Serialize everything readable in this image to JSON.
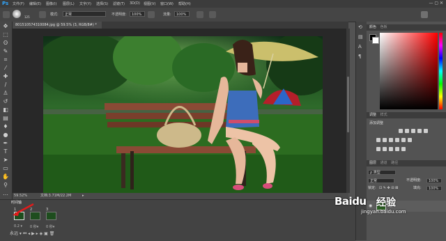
{
  "app": {
    "logo": "Ps"
  },
  "menubar": {
    "items": [
      "文件(F)",
      "编辑(E)",
      "图像(I)",
      "图层(L)",
      "文字(Y)",
      "选择(S)",
      "滤镜(T)",
      "3D(D)",
      "视图(V)",
      "窗口(W)",
      "帮助(H)"
    ]
  },
  "window_controls": {
    "minimize": "—",
    "maximize": "▢",
    "close": "✕"
  },
  "options": {
    "brush_size": "125",
    "mode_label": "模式:",
    "mode_value": "正常",
    "opacity_label": "不透明度:",
    "opacity_value": "100%",
    "flow_label": "流量:",
    "flow_value": "100%"
  },
  "document": {
    "tab_title": "801510574310084.jpg @ 59.5% (3, RGB/8#) *",
    "tab_close": "×",
    "zoom": "59.52%",
    "doc_size": "文档:3.71M/22.2M"
  },
  "timeline": {
    "tab": "时间轴",
    "frames": [
      {
        "num": "1",
        "delay": "0.2 ▾"
      },
      {
        "num": "2",
        "delay": "0 秒▾"
      },
      {
        "num": "3",
        "delay": "0 秒▾"
      }
    ],
    "loop": "永远 ▾"
  },
  "panels": {
    "color_tab": "颜色",
    "swatches_tab": "色板",
    "adjust_tab": "调整",
    "styles_tab": "样式",
    "adjust_title": "添加调整",
    "layers_tab": "图层",
    "channels_tab": "通道",
    "paths_tab": "路径",
    "kind_label": "ρ 类型",
    "blend_value": "正常",
    "layer_opacity_label": "不透明度:",
    "layer_opacity_value": "100%",
    "lock_label": "锁定:",
    "fill_label": "填充:",
    "fill_value": "100%",
    "lock_icons": "⊡ ✎ ✥ ⊟ ⊠",
    "layer_name_prefix": "☑ 帧",
    "layer_name": "帧 1"
  },
  "watermark": {
    "logo": "Baidu",
    "text": "经验",
    "url": "jingyan.baidu.com"
  }
}
